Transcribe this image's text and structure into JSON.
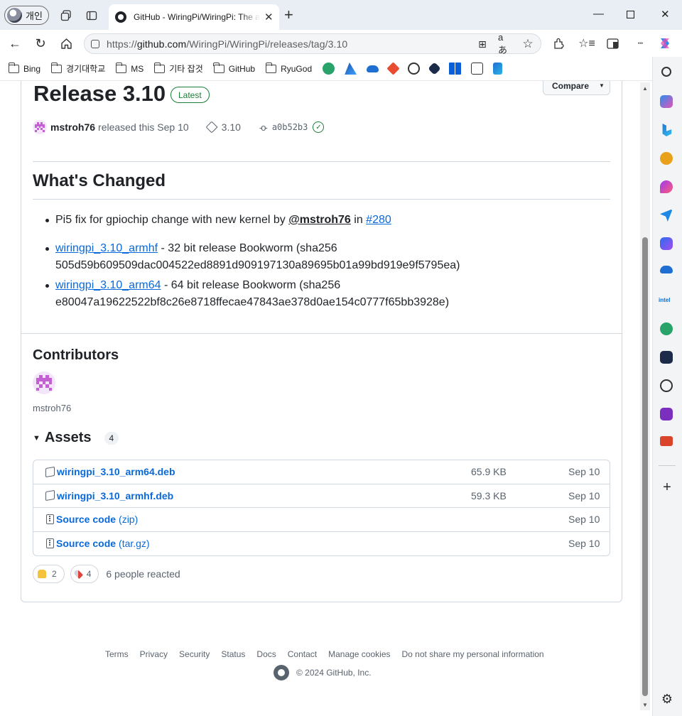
{
  "browser": {
    "profile_label": "개인",
    "tab_title": "GitHub - WiringPi/WiringPi: The arguably fastest GPIO Library for the Raspberry Pi",
    "url_prefix": "https://",
    "url_host": "github.com",
    "url_path": "/WiringPi/WiringPi/releases/tag/3.10",
    "bookmarks": [
      {
        "label": "Bing",
        "type": "folder"
      },
      {
        "label": "경기대학교",
        "type": "folder"
      },
      {
        "label": "MS",
        "type": "folder"
      },
      {
        "label": "기타 잡것",
        "type": "folder"
      },
      {
        "label": "GitHub",
        "type": "folder"
      },
      {
        "label": "RyuGod",
        "type": "folder"
      }
    ],
    "bookmark_icons": [
      "chatgpt-alt-icon",
      "azure-icon",
      "onedrive-icon",
      "git-icon",
      "openai-icon",
      "copilot-icon",
      "windows-icon",
      "wallet-icon",
      "tools-icon"
    ],
    "sidebar_text": "intel"
  },
  "release": {
    "title": "Release 3.10",
    "latest_badge": "Latest",
    "compare_label": "Compare",
    "author": "mstroh76",
    "released_text": "released this Sep 10",
    "tag": "3.10",
    "commit": "a0b52b3"
  },
  "changes": {
    "heading": "What's Changed",
    "item1_text": "Pi5 fix for gpiochip change with new kernel by",
    "item1_mention": "@mstroh76",
    "item1_in": "in",
    "item1_pr": "#280",
    "item2_link": "wiringpi_3.10_armhf",
    "item2_text": "- 32 bit release Bookworm (sha256",
    "item2_hash": "505d59b609509dac004522ed8891d909197130a89695b01a99bd919e9f5795ea)",
    "item3_link": "wiringpi_3.10_arm64",
    "item3_text": "- 64 bit release Bookworm (sha256",
    "item3_hash": "e80047a19622522bf8c26e8718ffecae47843ae378d0ae154c0777f65bb3928e)"
  },
  "contributors": {
    "heading": "Contributors",
    "name": "mstroh76"
  },
  "assets": {
    "heading": "Assets",
    "count": "4",
    "rows": [
      {
        "name": "wiringpi_3.10_arm64.deb",
        "ext": "",
        "size": "65.9 KB",
        "date": "Sep 10"
      },
      {
        "name": "wiringpi_3.10_armhf.deb",
        "ext": "",
        "size": "59.3 KB",
        "date": "Sep 10"
      },
      {
        "name": "Source code",
        "ext": "(zip)",
        "size": "",
        "date": "Sep 10"
      },
      {
        "name": "Source code",
        "ext": "(tar.gz)",
        "size": "",
        "date": "Sep 10"
      }
    ]
  },
  "reactions": {
    "thumbs_count": "2",
    "rocket_count": "4",
    "summary": "6 people reacted"
  },
  "footer": {
    "links": [
      "Terms",
      "Privacy",
      "Security",
      "Status",
      "Docs",
      "Contact",
      "Manage cookies",
      "Do not share my personal information"
    ],
    "copyright": "© 2024 GitHub, Inc."
  },
  "colors": {
    "link": "#0969da",
    "latest_green": "#1a7f37",
    "identicon": "#c45fd4"
  }
}
